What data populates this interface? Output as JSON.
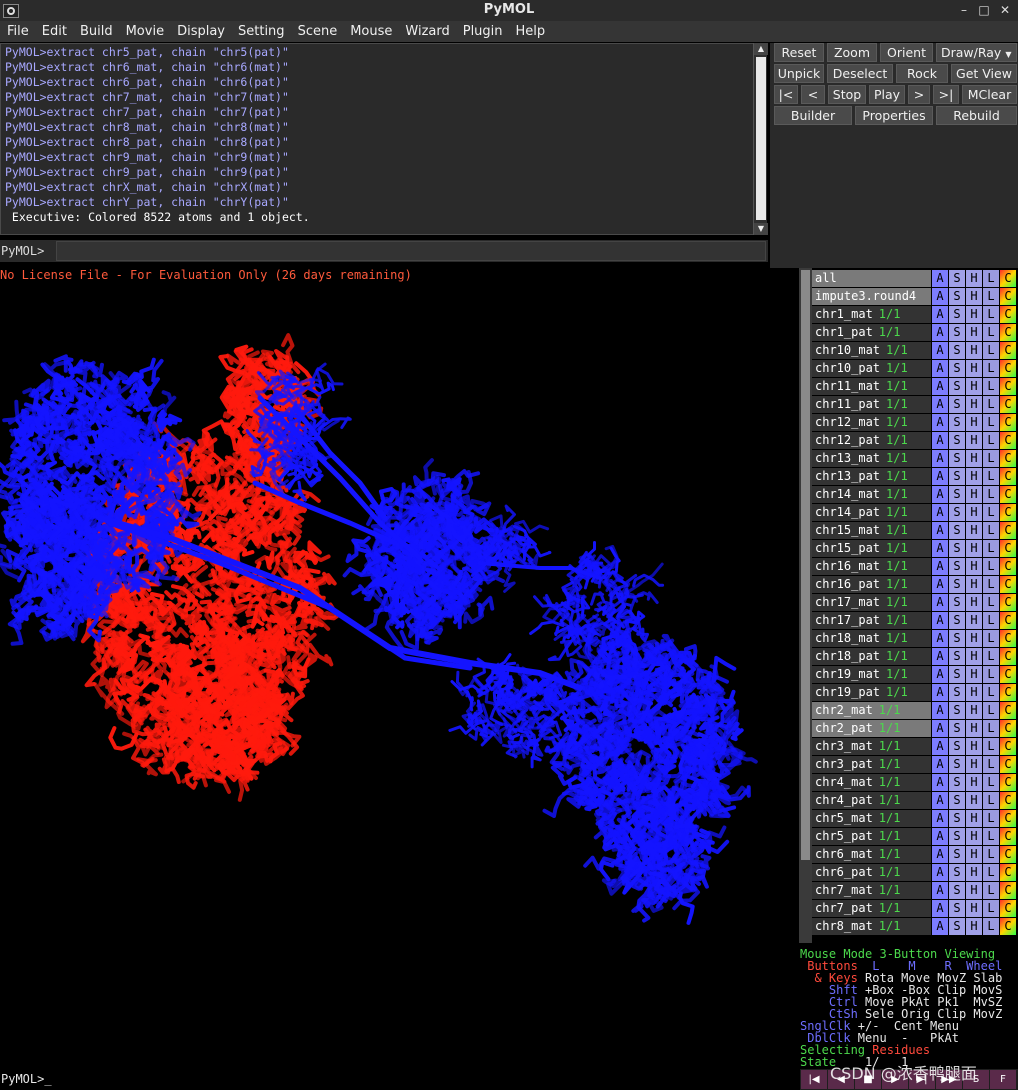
{
  "window": {
    "title": "PyMOL",
    "minimize": "–",
    "maximize": "□",
    "close": "✕"
  },
  "menubar": [
    "File",
    "Edit",
    "Build",
    "Movie",
    "Display",
    "Setting",
    "Scene",
    "Mouse",
    "Wizard",
    "Plugin",
    "Help"
  ],
  "log": {
    "lines": [
      "PyMOL>extract chr5_pat, chain \"chr5(pat)\"",
      "PyMOL>extract chr6_mat, chain \"chr6(mat)\"",
      "PyMOL>extract chr6_pat, chain \"chr6(pat)\"",
      "PyMOL>extract chr7_mat, chain \"chr7(mat)\"",
      "PyMOL>extract chr7_pat, chain \"chr7(pat)\"",
      "PyMOL>extract chr8_mat, chain \"chr8(mat)\"",
      "PyMOL>extract chr8_pat, chain \"chr8(pat)\"",
      "PyMOL>extract chr9_mat, chain \"chr9(mat)\"",
      "PyMOL>extract chr9_pat, chain \"chr9(pat)\"",
      "PyMOL>extract chrX_mat, chain \"chrX(mat)\"",
      "PyMOL>extract chrY_pat, chain \"chrY(pat)\""
    ],
    "output": " Executive: Colored 8522 atoms and 1 object."
  },
  "command": {
    "prompt": "PyMOL>",
    "value": ""
  },
  "buttons": {
    "row1": [
      "Reset",
      "Zoom",
      "Orient",
      "Draw/Ray"
    ],
    "row2": [
      "Unpick",
      "Deselect",
      "Rock",
      "Get View"
    ],
    "row3": [
      "|<",
      "<",
      "Stop",
      "Play",
      ">",
      ">|",
      "MClear"
    ],
    "row4": [
      "Builder",
      "Properties",
      "Rebuild"
    ]
  },
  "viewer": {
    "license": "No License File - For Evaluation Only (26 days remaining)",
    "colors": {
      "maternal": "#ff1a0d",
      "paternal": "#1414ff"
    }
  },
  "objects": [
    {
      "name": "all",
      "state": "",
      "highlight": true
    },
    {
      "name": "impute3.round4",
      "state": "",
      "highlight": true
    },
    {
      "name": "chr1_mat",
      "state": "1/1",
      "highlight": false
    },
    {
      "name": "chr1_pat",
      "state": "1/1",
      "highlight": false
    },
    {
      "name": "chr10_mat",
      "state": "1/1",
      "highlight": false
    },
    {
      "name": "chr10_pat",
      "state": "1/1",
      "highlight": false
    },
    {
      "name": "chr11_mat",
      "state": "1/1",
      "highlight": false
    },
    {
      "name": "chr11_pat",
      "state": "1/1",
      "highlight": false
    },
    {
      "name": "chr12_mat",
      "state": "1/1",
      "highlight": false
    },
    {
      "name": "chr12_pat",
      "state": "1/1",
      "highlight": false
    },
    {
      "name": "chr13_mat",
      "state": "1/1",
      "highlight": false
    },
    {
      "name": "chr13_pat",
      "state": "1/1",
      "highlight": false
    },
    {
      "name": "chr14_mat",
      "state": "1/1",
      "highlight": false
    },
    {
      "name": "chr14_pat",
      "state": "1/1",
      "highlight": false
    },
    {
      "name": "chr15_mat",
      "state": "1/1",
      "highlight": false
    },
    {
      "name": "chr15_pat",
      "state": "1/1",
      "highlight": false
    },
    {
      "name": "chr16_mat",
      "state": "1/1",
      "highlight": false
    },
    {
      "name": "chr16_pat",
      "state": "1/1",
      "highlight": false
    },
    {
      "name": "chr17_mat",
      "state": "1/1",
      "highlight": false
    },
    {
      "name": "chr17_pat",
      "state": "1/1",
      "highlight": false
    },
    {
      "name": "chr18_mat",
      "state": "1/1",
      "highlight": false
    },
    {
      "name": "chr18_pat",
      "state": "1/1",
      "highlight": false
    },
    {
      "name": "chr19_mat",
      "state": "1/1",
      "highlight": false
    },
    {
      "name": "chr19_pat",
      "state": "1/1",
      "highlight": false
    },
    {
      "name": "chr2_mat",
      "state": "1/1",
      "highlight": true
    },
    {
      "name": "chr2_pat",
      "state": "1/1",
      "highlight": true
    },
    {
      "name": "chr3_mat",
      "state": "1/1",
      "highlight": false
    },
    {
      "name": "chr3_pat",
      "state": "1/1",
      "highlight": false
    },
    {
      "name": "chr4_mat",
      "state": "1/1",
      "highlight": false
    },
    {
      "name": "chr4_pat",
      "state": "1/1",
      "highlight": false
    },
    {
      "name": "chr5_mat",
      "state": "1/1",
      "highlight": false
    },
    {
      "name": "chr5_pat",
      "state": "1/1",
      "highlight": false
    },
    {
      "name": "chr6_mat",
      "state": "1/1",
      "highlight": false
    },
    {
      "name": "chr6_pat",
      "state": "1/1",
      "highlight": false
    },
    {
      "name": "chr7_mat",
      "state": "1/1",
      "highlight": false
    },
    {
      "name": "chr7_pat",
      "state": "1/1",
      "highlight": false
    },
    {
      "name": "chr8_mat",
      "state": "1/1",
      "highlight": false
    }
  ],
  "object_actions": [
    "A",
    "S",
    "H",
    "L",
    "C"
  ],
  "mouse": {
    "line1": "Mouse Mode 3-Button Viewing",
    "buttons_label": " Buttons",
    "buttons_cols": "  L    M    R  Wheel",
    "keys_label": "  & Keys",
    "keys_vals": " Rota Move MovZ Slab",
    "shft_label": "    Shft",
    "shft_vals": " +Box -Box Clip MovS",
    "ctrl_label": "    Ctrl",
    "ctrl_vals": " Move PkAt Pk1  MvSZ",
    "ctsh_label": "    CtSh",
    "ctsh_vals": " Sele Orig Clip MovZ",
    "sngl_label": "SnglClk",
    "sngl_vals": " +/-  Cent Menu",
    "dbl_label": " DblClk",
    "dbl_vals": " Menu  -   PkAt",
    "selecting_a": "Selecting ",
    "selecting_b": "Residues",
    "state_label": "State",
    "state_vals": "    1/   1"
  },
  "bottom_prompt": "PyMOL>_",
  "playback": [
    "|◀",
    "◀",
    "■",
    "▶",
    "▶|",
    "▶▶",
    "S",
    "F"
  ],
  "watermark": "CSDN @浓香鸭腿面"
}
